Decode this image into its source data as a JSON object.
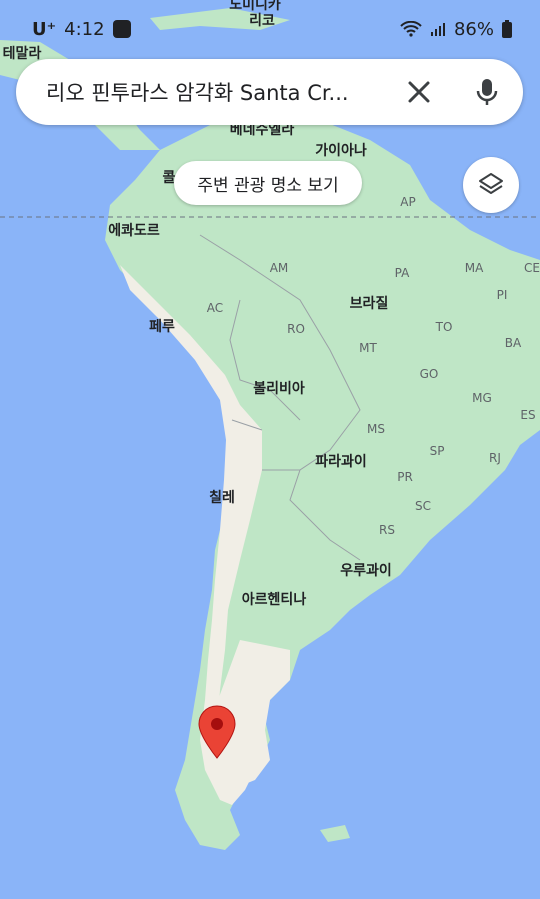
{
  "status_bar": {
    "carrier": "U⁺",
    "time": "4:12",
    "battery": "86%"
  },
  "search": {
    "query": "리오 핀투라스 암각화 Santa Cr...",
    "clear_icon": "close-icon",
    "voice_icon": "mic-icon"
  },
  "chip": {
    "label": "주변 관광 명소 보기"
  },
  "layers_button": {
    "icon": "layers-icon"
  },
  "map": {
    "water_color": "#8ab4f8",
    "land_color": "#bfe6c6",
    "dry_land_color": "#f1eee6",
    "pin_color": "#ea4335",
    "labels": [
      {
        "id": "dominicana",
        "text": "도미니카"
      },
      {
        "id": "costa-rica",
        "text": "리코"
      },
      {
        "id": "guatemala",
        "text": "테말라"
      },
      {
        "id": "venezuela",
        "text": "베네수엘라"
      },
      {
        "id": "guyana",
        "text": "가이아나"
      },
      {
        "id": "colombia",
        "text": "콜"
      },
      {
        "id": "ecuador",
        "text": "에콰도르"
      },
      {
        "id": "peru",
        "text": "페루"
      },
      {
        "id": "brazil",
        "text": "브라질"
      },
      {
        "id": "bolivia",
        "text": "볼리비아"
      },
      {
        "id": "paraguay",
        "text": "파라과이"
      },
      {
        "id": "chile",
        "text": "칠레"
      },
      {
        "id": "uruguay",
        "text": "우루과이"
      },
      {
        "id": "argentina",
        "text": "아르헨티나"
      },
      {
        "id": "ap",
        "text": "AP"
      },
      {
        "id": "am",
        "text": "AM"
      },
      {
        "id": "pa",
        "text": "PA"
      },
      {
        "id": "ma",
        "text": "MA"
      },
      {
        "id": "ce",
        "text": "CE"
      },
      {
        "id": "pi",
        "text": "PI"
      },
      {
        "id": "ac",
        "text": "AC"
      },
      {
        "id": "ro",
        "text": "RO"
      },
      {
        "id": "to",
        "text": "TO"
      },
      {
        "id": "ba",
        "text": "BA"
      },
      {
        "id": "mt",
        "text": "MT"
      },
      {
        "id": "go",
        "text": "GO"
      },
      {
        "id": "mg",
        "text": "MG"
      },
      {
        "id": "es",
        "text": "ES"
      },
      {
        "id": "ms",
        "text": "MS"
      },
      {
        "id": "sp",
        "text": "SP"
      },
      {
        "id": "rj",
        "text": "RJ"
      },
      {
        "id": "pr",
        "text": "PR"
      },
      {
        "id": "sc",
        "text": "SC"
      },
      {
        "id": "rs",
        "text": "RS"
      }
    ]
  }
}
